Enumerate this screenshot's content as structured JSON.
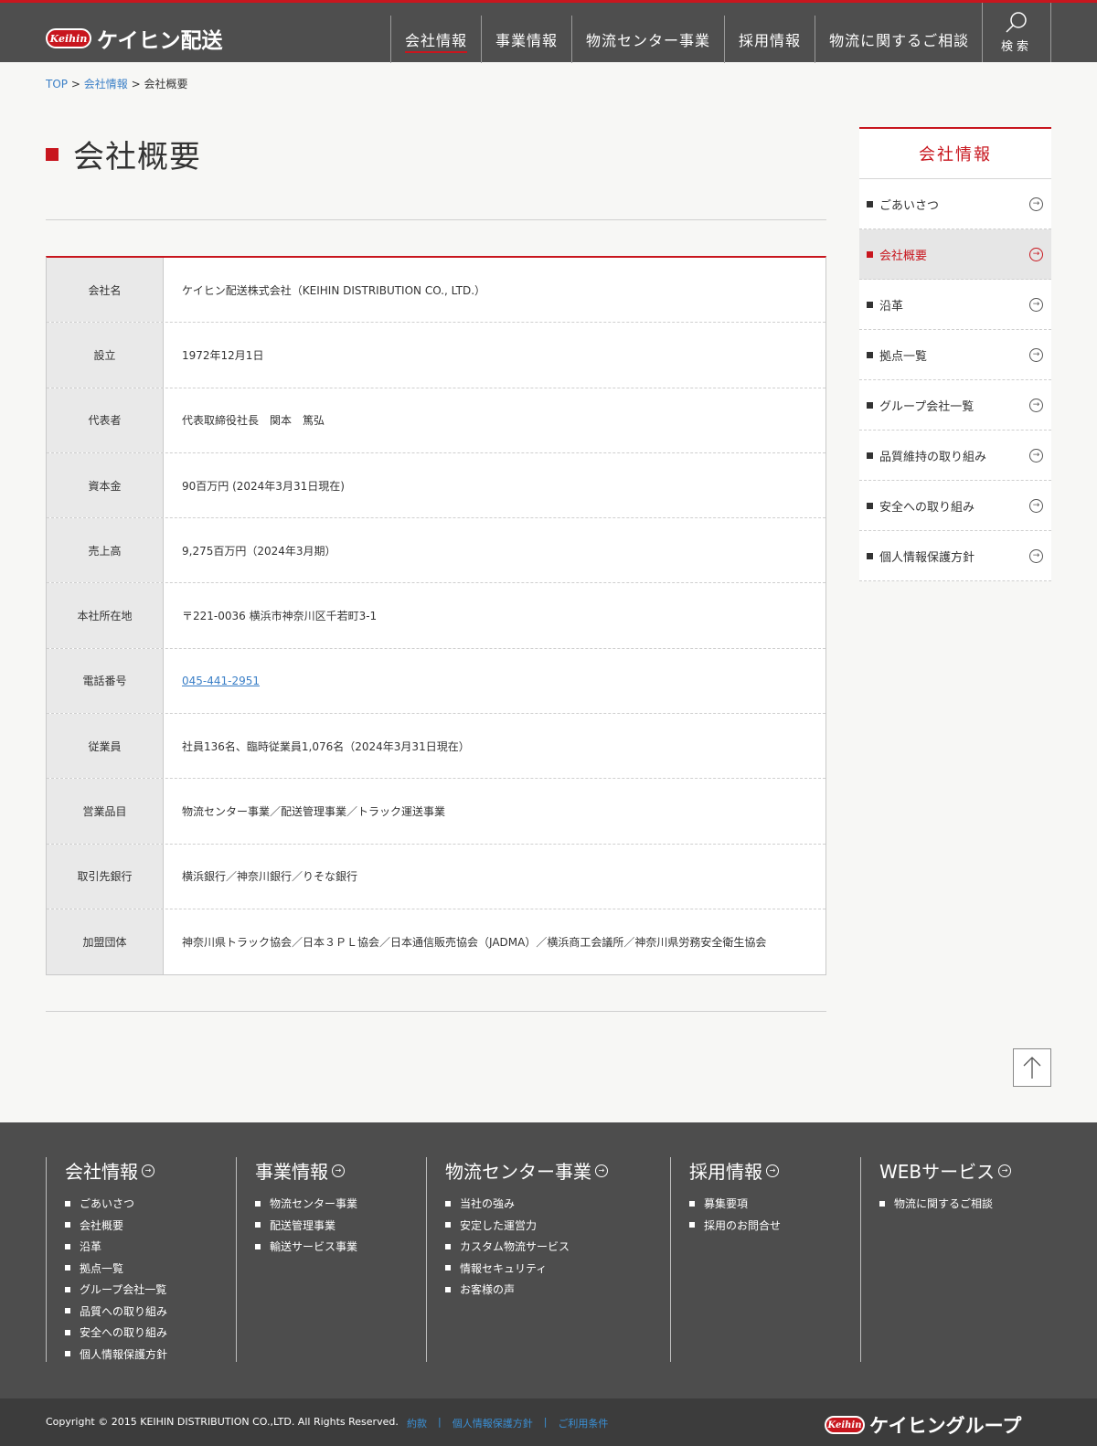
{
  "header": {
    "logo_badge": "Keihin",
    "logo_text": "ケイヒン配送",
    "nav": [
      "会社情報",
      "事業情報",
      "物流センター事業",
      "採用情報",
      "物流に関するご相談"
    ],
    "search_label": "検索"
  },
  "breadcrumb": {
    "top": "TOP",
    "sep": ">",
    "company": "会社情報",
    "current": "会社概要"
  },
  "page_title": "会社概要",
  "table": [
    {
      "label": "会社名",
      "value": "ケイヒン配送株式会社（KEIHIN DISTRIBUTION CO., LTD.）"
    },
    {
      "label": "設立",
      "value": "1972年12月1日"
    },
    {
      "label": "代表者",
      "value": "代表取締役社長　関本　篤弘"
    },
    {
      "label": "資本金",
      "value": "90百万円 (2024年3月31日現在)"
    },
    {
      "label": "売上高",
      "value": "9,275百万円（2024年3月期）"
    },
    {
      "label": "本社所在地",
      "value": "〒221-0036 横浜市神奈川区千若町3-1"
    },
    {
      "label": "電話番号",
      "value": "045-441-2951"
    },
    {
      "label": "従業員",
      "value": "社員136名、臨時従業員1,076名（2024年3月31日現在）"
    },
    {
      "label": "営業品目",
      "value": "物流センター事業／配送管理事業／トラック運送事業"
    },
    {
      "label": "取引先銀行",
      "value": "横浜銀行／神奈川銀行／りそな銀行"
    },
    {
      "label": "加盟団体",
      "value": "神奈川県トラック協会／日本３ＰＬ協会／日本通信販売協会（JADMA）／横浜商工会議所／神奈川県労務安全衛生協会"
    }
  ],
  "sidebar": {
    "title": "会社情報",
    "items": [
      "ごあいさつ",
      "会社概要",
      "沿革",
      "拠点一覧",
      "グループ会社一覧",
      "品質維持の取り組み",
      "安全への取り組み",
      "個人情報保護方針"
    ],
    "active_index": 1
  },
  "footer": {
    "columns": [
      {
        "title": "会社情報",
        "links": [
          "ごあいさつ",
          "会社概要",
          "沿革",
          "拠点一覧",
          "グループ会社一覧",
          "品質への取り組み",
          "安全への取り組み",
          "個人情報保護方針"
        ]
      },
      {
        "title": "事業情報",
        "links": [
          "物流センター事業",
          "配送管理事業",
          "輸送サービス事業"
        ]
      },
      {
        "title": "物流センター事業",
        "links": [
          "当社の強み",
          "安定した運営力",
          "カスタム物流サービス",
          "情報セキュリティ",
          "お客様の声"
        ]
      },
      {
        "title": "採用情報",
        "links": [
          "募集要項",
          "採用のお問合せ"
        ]
      },
      {
        "title": "WEBサービス",
        "links": [
          "物流に関するご相談"
        ]
      }
    ],
    "copyright": "Copyright © 2015 KEIHIN DISTRIBUTION CO.,LTD. All Rights Reserved.",
    "bottom_links": [
      "約款",
      "個人情報保護方針",
      "ご利用条件"
    ],
    "link_separator": "|",
    "group_badge": "Keihin",
    "group_logo_text": "ケイヒングループ"
  },
  "colors": {
    "accent": "#c8161e",
    "header_bg": "#4e4e4e",
    "footer_bg": "#4d4d4d",
    "link": "#3a7fc7"
  }
}
